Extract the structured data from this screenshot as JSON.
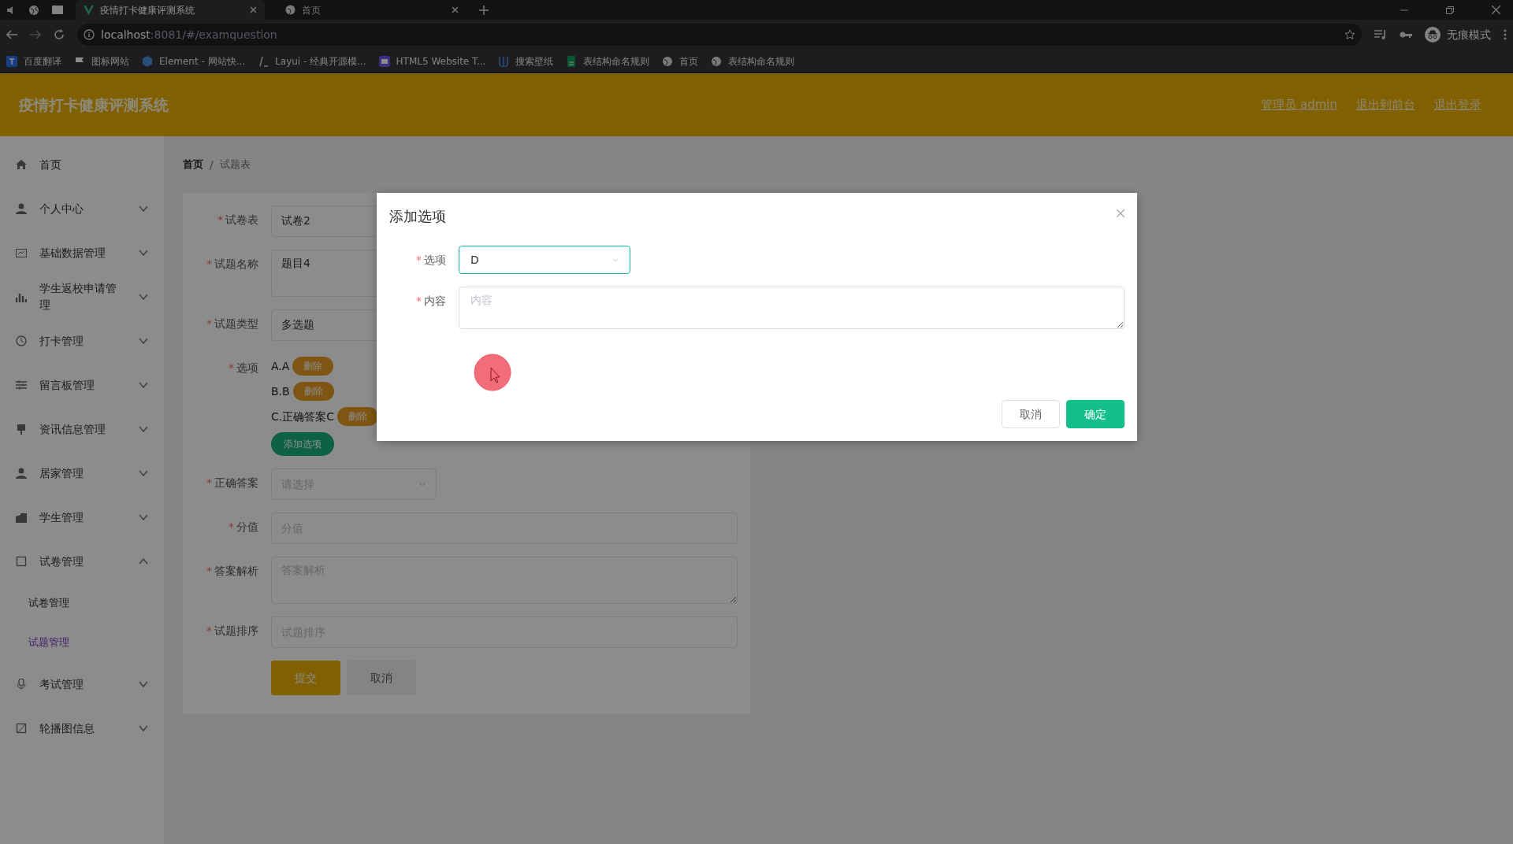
{
  "browser": {
    "tabs": [
      {
        "title": "疫情打卡健康评测系统",
        "selected": true
      },
      {
        "title": "首页",
        "selected": false
      }
    ],
    "url_host": "localhost",
    "url_rest": ":8081/#/examquestion",
    "profile": "无痕模式",
    "bookmarks": [
      "百度翻译",
      "图标网站",
      "Element - 网站快...",
      "Layui - 经典开源模...",
      "HTML5 Website T...",
      "搜索壁纸",
      "表结构命名规则",
      "首页",
      "表结构命名规则"
    ]
  },
  "header": {
    "title": "疫情打卡健康评测系统",
    "links": [
      "管理员 admin",
      "退出到前台",
      "退出登录"
    ]
  },
  "sidebar": {
    "items": [
      {
        "label": "首页",
        "kind": "link"
      },
      {
        "label": "个人中心",
        "kind": "menu",
        "expanded": false
      },
      {
        "label": "基础数据管理",
        "kind": "menu",
        "expanded": false
      },
      {
        "label": "学生返校申请管理",
        "kind": "menu",
        "expanded": false
      },
      {
        "label": "打卡管理",
        "kind": "menu",
        "expanded": false
      },
      {
        "label": "留言板管理",
        "kind": "menu",
        "expanded": false
      },
      {
        "label": "资讯信息管理",
        "kind": "menu",
        "expanded": false
      },
      {
        "label": "居家管理",
        "kind": "menu",
        "expanded": false
      },
      {
        "label": "学生管理",
        "kind": "menu",
        "expanded": false
      },
      {
        "label": "试卷管理",
        "kind": "menu",
        "expanded": true,
        "children": [
          {
            "label": "试卷管理",
            "selected": false
          },
          {
            "label": "试题管理",
            "selected": true
          }
        ]
      },
      {
        "label": "考试管理",
        "kind": "menu",
        "expanded": false
      },
      {
        "label": "轮播图信息",
        "kind": "menu",
        "expanded": false
      }
    ]
  },
  "breadcrumb": [
    "首页",
    "试题表"
  ],
  "breadcrumb_separator": "/",
  "form": {
    "fields": [
      {
        "kind": "text",
        "label": "试卷表",
        "required_mark": "*",
        "value": "试卷2"
      },
      {
        "kind": "textarea",
        "label": "试题名称",
        "required_mark": "*",
        "value": "题目4"
      },
      {
        "kind": "text",
        "label": "试题类型",
        "required_mark": "*",
        "value": "多选题"
      },
      {
        "kind": "options",
        "label": "选项",
        "required_mark": "*",
        "options": [
          {
            "text": "A.A",
            "action": "删除"
          },
          {
            "text": "B.B",
            "action": "删除"
          },
          {
            "text": "C.正确答案C",
            "action": "删除"
          }
        ],
        "add": "添加选项"
      },
      {
        "kind": "select",
        "label": "正确答案",
        "required_mark": "*",
        "placeholder": "请选择"
      },
      {
        "kind": "text",
        "label": "分值",
        "required_mark": "*",
        "placeholder": "分值"
      },
      {
        "kind": "textarea",
        "label": "答案解析",
        "required_mark": "*",
        "placeholder": "答案解析"
      },
      {
        "kind": "text",
        "label": "试题排序",
        "required_mark": "*",
        "placeholder": "试题排序"
      }
    ],
    "buttons": [
      {
        "label": "提交",
        "kind": "primary"
      },
      {
        "label": "取消",
        "kind": "default"
      }
    ]
  },
  "dialog": {
    "title": "添加选项",
    "fields": [
      {
        "kind": "select",
        "label": "选项",
        "required_mark": "*",
        "value": "D",
        "focused": true
      },
      {
        "kind": "textarea",
        "label": "内容",
        "required_mark": "*",
        "placeholder": "内容"
      }
    ],
    "buttons": [
      {
        "label": "取消",
        "kind": "default"
      },
      {
        "label": "确定",
        "kind": "primary"
      }
    ]
  }
}
